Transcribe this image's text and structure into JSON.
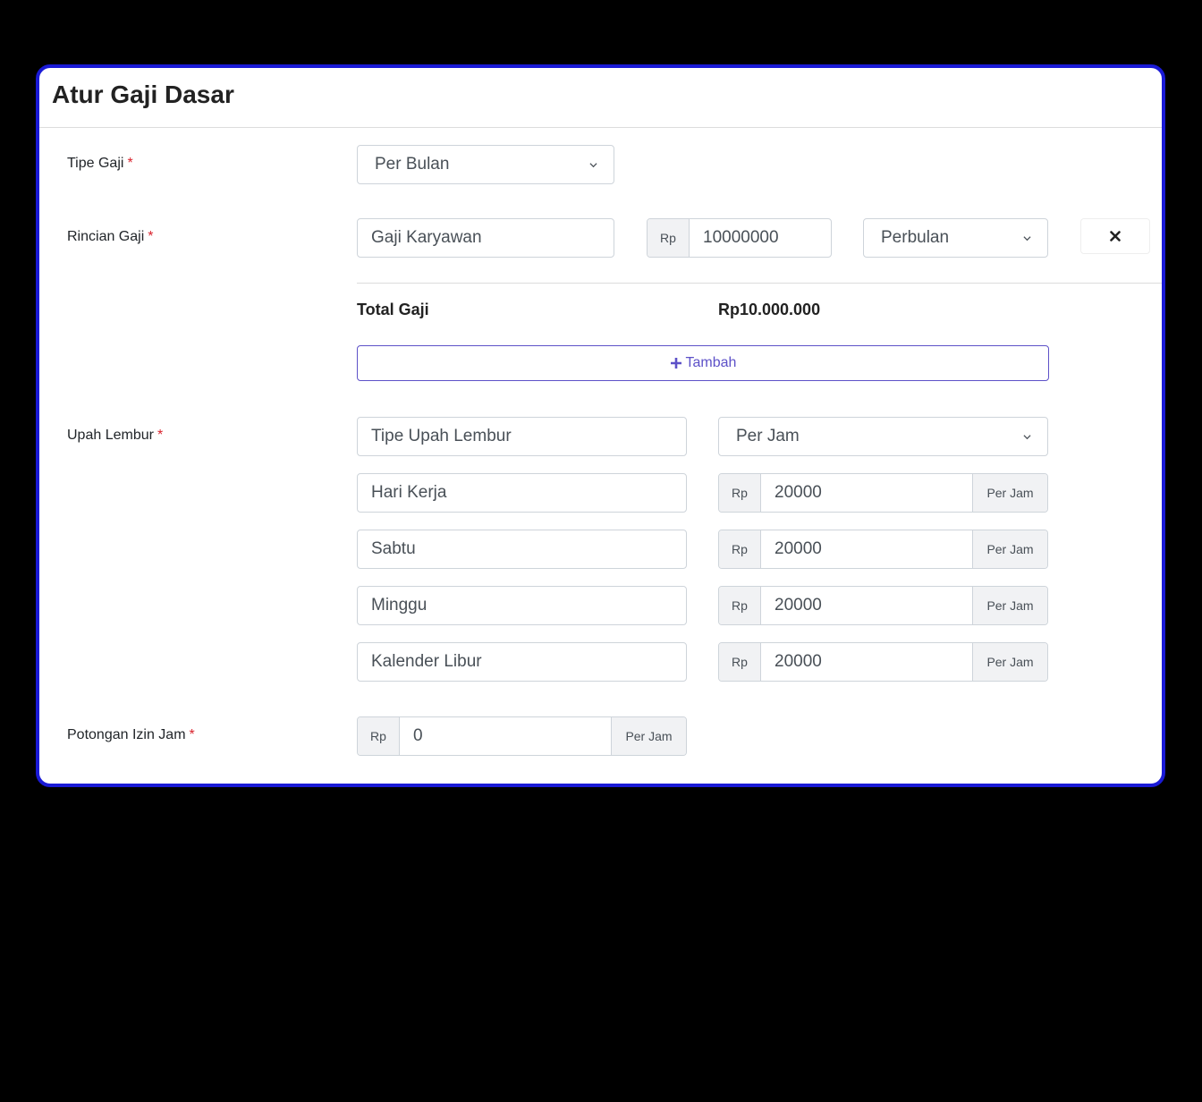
{
  "title": "Atur Gaji Dasar",
  "required_mark": "*",
  "tipe_gaji": {
    "label": "Tipe Gaji",
    "selected": "Per Bulan"
  },
  "rincian_gaji": {
    "label": "Rincian Gaji",
    "name_value": "Gaji Karyawan",
    "currency": "Rp",
    "amount": "10000000",
    "period_selected": "Perbulan",
    "remove_icon": "close-icon"
  },
  "total": {
    "label": "Total Gaji",
    "value": "Rp10.000.000"
  },
  "add_button": {
    "icon": "plus-icon",
    "label": "Tambah"
  },
  "upah_lembur": {
    "label": "Upah Lembur",
    "type_name": "Tipe Upah Lembur",
    "type_selected": "Per Jam",
    "rows": [
      {
        "name": "Hari Kerja",
        "currency": "Rp",
        "amount": "20000",
        "unit": "Per Jam"
      },
      {
        "name": "Sabtu",
        "currency": "Rp",
        "amount": "20000",
        "unit": "Per Jam"
      },
      {
        "name": "Minggu",
        "currency": "Rp",
        "amount": "20000",
        "unit": "Per Jam"
      },
      {
        "name": "Kalender Libur",
        "currency": "Rp",
        "amount": "20000",
        "unit": "Per Jam"
      }
    ]
  },
  "potongan_izin": {
    "label": "Potongan Izin Jam",
    "currency": "Rp",
    "amount": "0",
    "unit": "Per Jam"
  },
  "colors": {
    "frame": "#1a1ad6",
    "accent": "#5d51c8",
    "required": "#d9232d"
  }
}
